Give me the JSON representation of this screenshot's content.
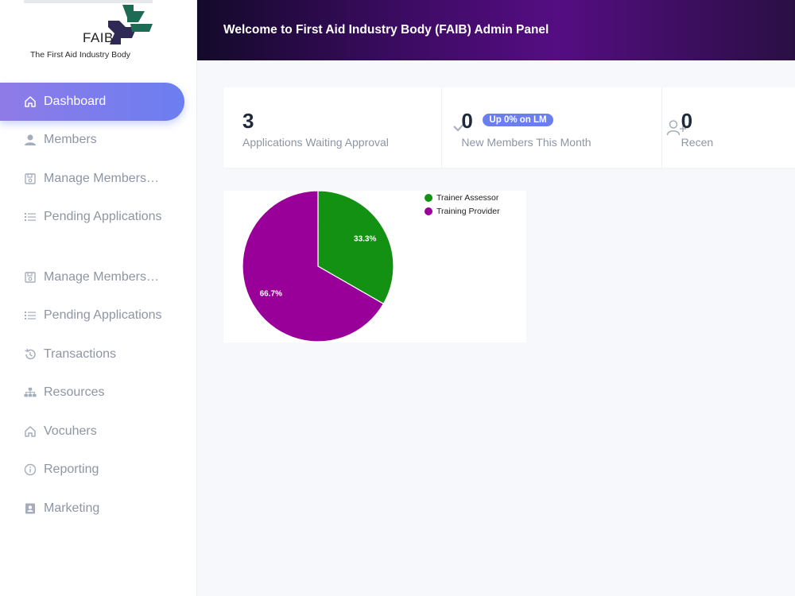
{
  "brand": {
    "name": "FAIB",
    "subtitle": "The First Aid Industry Body",
    "mark_colors": [
      "#2f2a55",
      "#1d6a55"
    ]
  },
  "header": {
    "title": "Welcome to First Aid Industry Body (FAIB) Admin Panel"
  },
  "sidebar": {
    "items": [
      {
        "label": "Dashboard",
        "icon": "home-icon",
        "active": true
      },
      {
        "label": "Members",
        "icon": "user-icon"
      },
      {
        "label": "Manage Membership",
        "icon": "save-icon"
      },
      {
        "label": "Pending Applications",
        "icon": "list-icon"
      },
      {
        "label": "Manage Membership",
        "icon": "save-icon"
      },
      {
        "label": "Pending Applications",
        "icon": "list-icon"
      },
      {
        "label": "Transactions",
        "icon": "history-icon"
      },
      {
        "label": "Resources",
        "icon": "sitemap-icon"
      },
      {
        "label": "Vocuhers",
        "icon": "home-icon"
      },
      {
        "label": "Reporting",
        "icon": "info-icon"
      },
      {
        "label": "Marketing",
        "icon": "contact-card-icon"
      }
    ]
  },
  "stats": [
    {
      "value": "3",
      "label": "Applications Waiting Approval",
      "icon": "check-icon"
    },
    {
      "value": "0",
      "label": "New Members This Month",
      "badge": "Up 0% on LM",
      "icon": "user-plus-icon"
    },
    {
      "value": "0",
      "label": "Recen"
    }
  ],
  "chart_data": {
    "type": "pie",
    "categories": [
      "Trainer Assessor",
      "Training Provider"
    ],
    "values": [
      33.3,
      66.7
    ],
    "data_labels": [
      "33.3%",
      "66.7%"
    ],
    "colors": [
      "#129112",
      "#990099"
    ],
    "legend": "top-right",
    "title": ""
  }
}
